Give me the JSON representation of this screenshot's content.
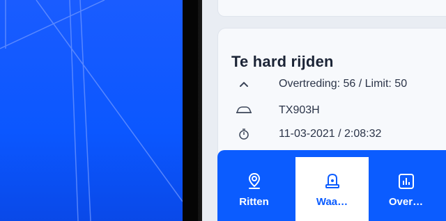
{
  "card": {
    "title": "Te hard rijden",
    "rows": [
      {
        "icon": "chevron-up-icon",
        "text": "Overtreding: 56 / Limit: 50"
      },
      {
        "icon": "car-icon",
        "text": "TX903H"
      },
      {
        "icon": "stopwatch-icon",
        "text": "11-03-2021 / 2:08:32"
      }
    ]
  },
  "nav": {
    "items": [
      {
        "label": "Ritten",
        "icon": "location-pin-icon",
        "active": false
      },
      {
        "label": "Waa…",
        "icon": "warning-light-icon",
        "active": true
      },
      {
        "label": "Over…",
        "icon": "bar-chart-icon",
        "active": false
      }
    ]
  },
  "colors": {
    "accent": "#0b5cff",
    "background_blue": "#1a5cff",
    "card": "#f7f9fc",
    "text": "#1b2436"
  }
}
